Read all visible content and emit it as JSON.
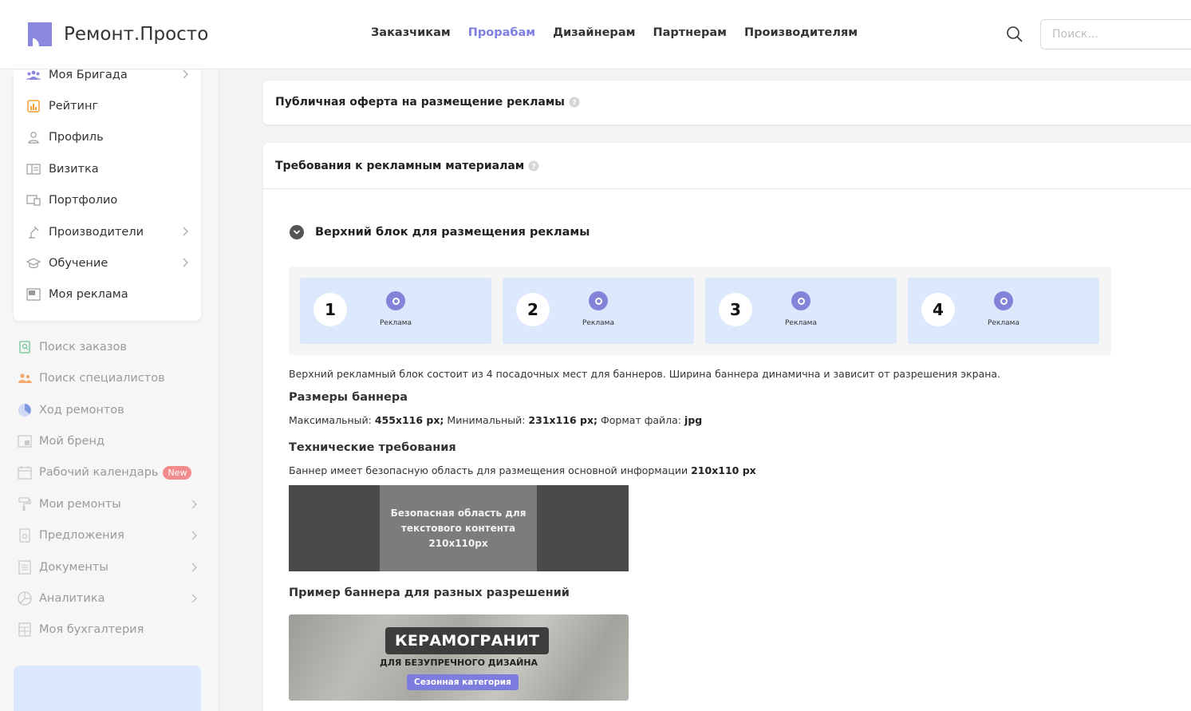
{
  "header": {
    "logo_text": "Ремонт.Просто",
    "nav": [
      {
        "label": "Заказчикам",
        "active": false
      },
      {
        "label": "Прорабам",
        "active": true
      },
      {
        "label": "Дизайнерам",
        "active": false
      },
      {
        "label": "Партнерам",
        "active": false
      },
      {
        "label": "Производителям",
        "active": false
      }
    ],
    "search_placeholder": "Поиск...",
    "accent_color": "#7f7fe3"
  },
  "sidebar": {
    "card_items": [
      {
        "label": "Моя Бригада",
        "icon": "team-icon",
        "chevron": true
      },
      {
        "label": "Рейтинг",
        "icon": "rating-icon",
        "chevron": false
      },
      {
        "label": "Профиль",
        "icon": "user-icon",
        "chevron": false
      },
      {
        "label": "Визитка",
        "icon": "card-icon",
        "chevron": false
      },
      {
        "label": "Портфолио",
        "icon": "portfolio-icon",
        "chevron": false
      },
      {
        "label": "Производители",
        "icon": "lamp-icon",
        "chevron": true
      },
      {
        "label": "Обучение",
        "icon": "graduation-icon",
        "chevron": true
      },
      {
        "label": "Моя реклама",
        "icon": "ad-icon",
        "chevron": false
      }
    ],
    "outer_items": [
      {
        "label": "Поиск заказов",
        "icon": "search-doc-icon",
        "chevron": false
      },
      {
        "label": "Поиск специалистов",
        "icon": "people-icon",
        "chevron": false
      },
      {
        "label": "Ход ремонтов",
        "icon": "progress-icon",
        "chevron": false
      },
      {
        "label": "Мой бренд",
        "icon": "brand-icon",
        "chevron": false
      },
      {
        "label": "Рабочий календарь",
        "icon": "calendar-icon",
        "chevron": false,
        "badge": "New"
      },
      {
        "label": "Мои ремонты",
        "icon": "roller-icon",
        "chevron": true
      },
      {
        "label": "Предложения",
        "icon": "offer-icon",
        "chevron": true
      },
      {
        "label": "Документы",
        "icon": "document-icon",
        "chevron": true
      },
      {
        "label": "Аналитика",
        "icon": "pie-icon",
        "chevron": true
      },
      {
        "label": "Моя бухгалтерия",
        "icon": "calculator-icon",
        "chevron": false
      }
    ]
  },
  "main": {
    "offer_title": "Публичная оферта на размещение рекламы",
    "requirements_title": "Требования к рекламным материалам",
    "section_title": "Верхний блок для размещения рекламы",
    "ad_slots": [
      {
        "number": "1",
        "label": "Реклама"
      },
      {
        "number": "2",
        "label": "Реклама"
      },
      {
        "number": "3",
        "label": "Реклама"
      },
      {
        "number": "4",
        "label": "Реклама"
      }
    ],
    "description": "Верхний рекламный блок состоит из 4 посадочных мест для баннеров. Ширина баннера динамична и зависит от разрешения экрана.",
    "sizes_title": "Размеры баннера",
    "sizes": {
      "max_label": "Максимальный:",
      "max_value": "455x116 px;",
      "min_label": "Минимальный:",
      "min_value": "231x116 px;",
      "format_label": "Формат файла:",
      "format_value": "jpg"
    },
    "tech_title": "Технические требования",
    "tech_text": "Баннер имеет безопасную область для размещения основной информации",
    "tech_value": "210x110 px",
    "safe_area_lines": [
      "Безопасная область для",
      "текстового контента",
      "210x110px"
    ],
    "example_title": "Пример баннера для разных разрешений",
    "example_banner": {
      "headline": "КЕРАМОГРАНИТ",
      "subline": "ДЛЯ БЕЗУПРЕЧНОГО ДИЗАЙНА",
      "chip": "Сезонная категория"
    }
  }
}
